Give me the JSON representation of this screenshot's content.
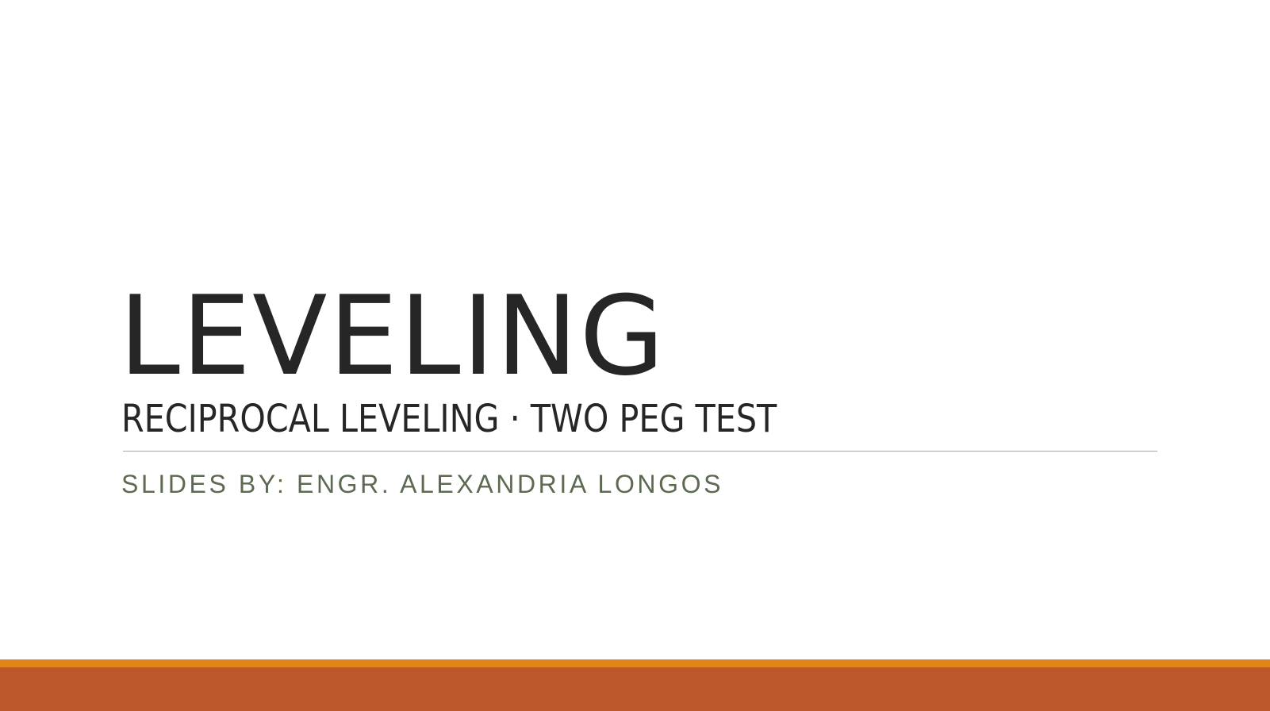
{
  "slide": {
    "title": "LEVELING",
    "subtitle": "RECIPROCAL LEVELING · TWO PEG TEST",
    "byline": "SLIDES BY: ENGR. ALEXANDRIA LONGOS"
  },
  "colors": {
    "text": "#262626",
    "byline": "#5c6a52",
    "divider": "#a6a6a6",
    "accent_orange": "#e2841c",
    "footer_rust": "#bd582c"
  }
}
